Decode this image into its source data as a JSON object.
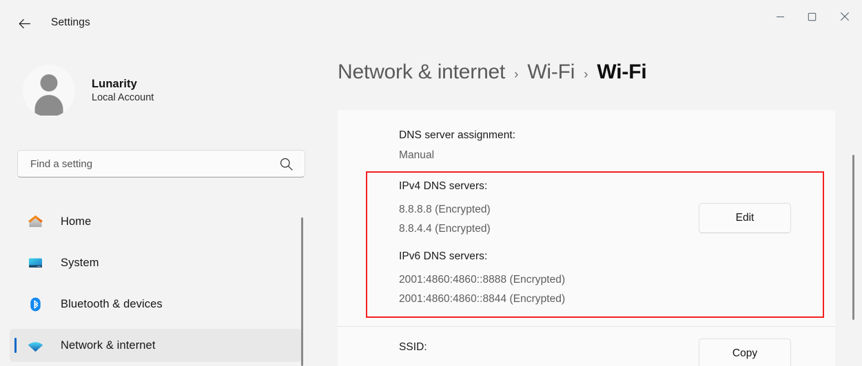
{
  "window": {
    "title": "Settings",
    "back_icon": "back-arrow-icon",
    "controls": {
      "minimize": "–",
      "maximize": "□",
      "close": "✕"
    }
  },
  "sidebar": {
    "account": {
      "name": "Lunarity",
      "type": "Local Account",
      "avatar_icon": "user-avatar-icon"
    },
    "search": {
      "placeholder": "Find a setting",
      "icon": "search-icon"
    },
    "items": [
      {
        "label": "Home",
        "icon": "home-icon",
        "selected": false
      },
      {
        "label": "System",
        "icon": "system-monitor-icon",
        "selected": false
      },
      {
        "label": "Bluetooth & devices",
        "icon": "bluetooth-icon",
        "selected": false
      },
      {
        "label": "Network & internet",
        "icon": "wifi-icon",
        "selected": true
      }
    ]
  },
  "breadcrumb": {
    "items": [
      "Network & internet",
      "Wi-Fi",
      "Wi-Fi"
    ],
    "separator": "›"
  },
  "main": {
    "dns_assignment": {
      "label": "DNS server assignment:",
      "value": "Manual"
    },
    "ipv4_dns": {
      "label": "IPv4 DNS servers:",
      "values": [
        "8.8.8.8 (Encrypted)",
        "8.8.4.4 (Encrypted)"
      ]
    },
    "ipv6_dns": {
      "label": "IPv6 DNS servers:",
      "values": [
        "2001:4860:4860::8888 (Encrypted)",
        "2001:4860:4860::8844 (Encrypted)"
      ]
    },
    "edit_button": "Edit",
    "ssid": {
      "label": "SSID:"
    },
    "copy_button": "Copy"
  },
  "highlight": {
    "color": "#f51f1f"
  },
  "colors": {
    "accent": "#0a68c9",
    "page_bg": "#f3f3f3",
    "card_bg": "#fafafa",
    "selected_row": "#e8e8e8"
  }
}
